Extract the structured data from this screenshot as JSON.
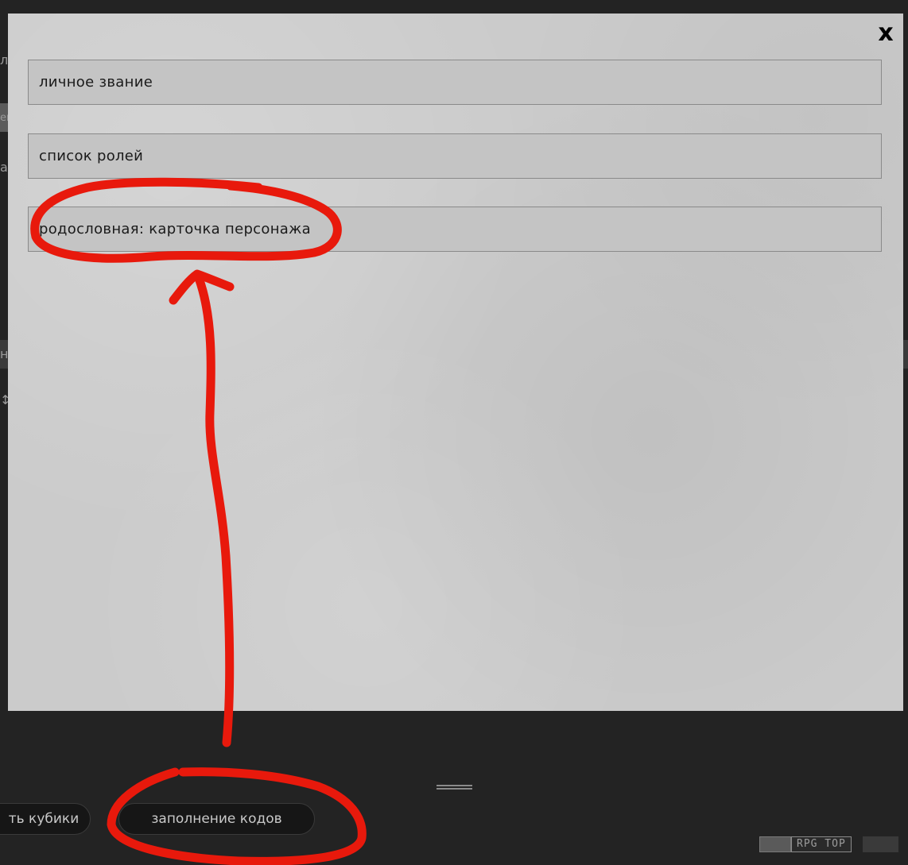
{
  "modal": {
    "close_label": "x",
    "fields": [
      {
        "label": "личное звание"
      },
      {
        "label": "список ролей"
      },
      {
        "label": "родословная: карточка персонажа"
      }
    ]
  },
  "toolbar": {
    "dice_button_label": "ть кубики",
    "codes_button_label": "заполнение кодов"
  },
  "footer": {
    "rpg_top_label": "RPG TOP"
  },
  "background_fragments": [
    "л",
    "ем",
    "ак",
    "н",
    "↕"
  ],
  "colors": {
    "page_background": "#232323",
    "modal_background": "#cbcbcb",
    "field_background": "#c4c4c4",
    "annotation_red": "#e8190c",
    "button_background": "#161616",
    "button_text": "#c9c9c9"
  },
  "icons": {
    "close": "close-icon",
    "resize": "drag-handle-icon",
    "rpg_top": "rpg-top-badge"
  }
}
